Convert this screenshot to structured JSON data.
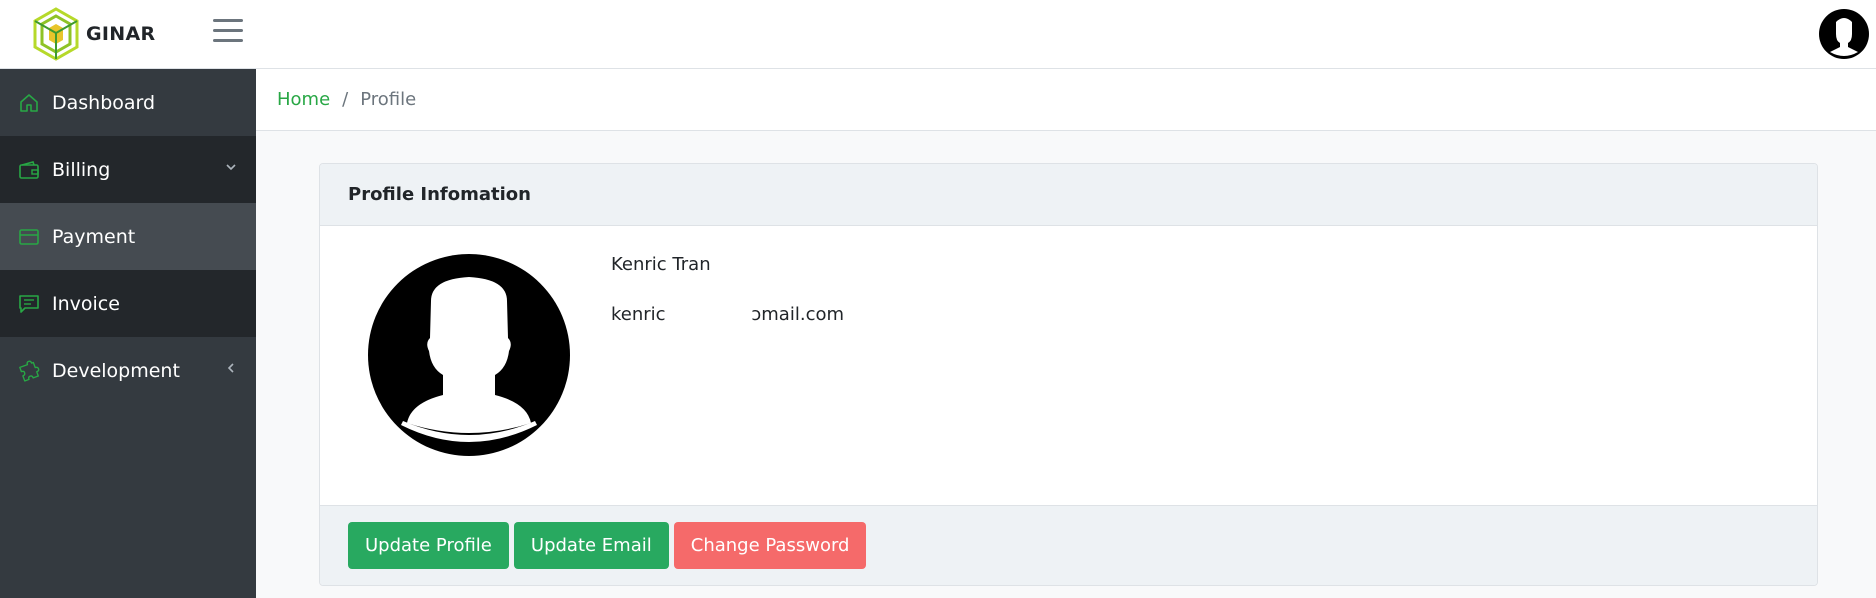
{
  "app": {
    "name": "GINAR",
    "logo_icon": "ginar-logo-icon",
    "menu_icon": "hamburger-menu-icon",
    "user_icon": "user-avatar-icon"
  },
  "sidebar": {
    "items": [
      {
        "label": "Dashboard",
        "icon": "home-icon"
      },
      {
        "label": "Billing",
        "icon": "wallet-icon",
        "chevron": "chevron-down-icon"
      },
      {
        "label": "Payment",
        "icon": "credit-card-icon"
      },
      {
        "label": "Invoice",
        "icon": "receipt-message-icon"
      },
      {
        "label": "Development",
        "icon": "puzzle-icon",
        "chevron": "chevron-left-icon"
      }
    ]
  },
  "breadcrumb": {
    "home": "Home",
    "separator": "/",
    "current": "Profile"
  },
  "profile": {
    "title": "Profile Infomation",
    "name": "Kenric Tran",
    "email": "kenric               ɔmail.com"
  },
  "actions": {
    "update_profile": "Update Profile",
    "update_email": "Update Email",
    "change_password": "Change Password"
  },
  "colors": {
    "accent_green": "#28a745",
    "button_green": "#28a960",
    "button_red": "#f56a6a",
    "sidebar_bg": "#343a40"
  }
}
